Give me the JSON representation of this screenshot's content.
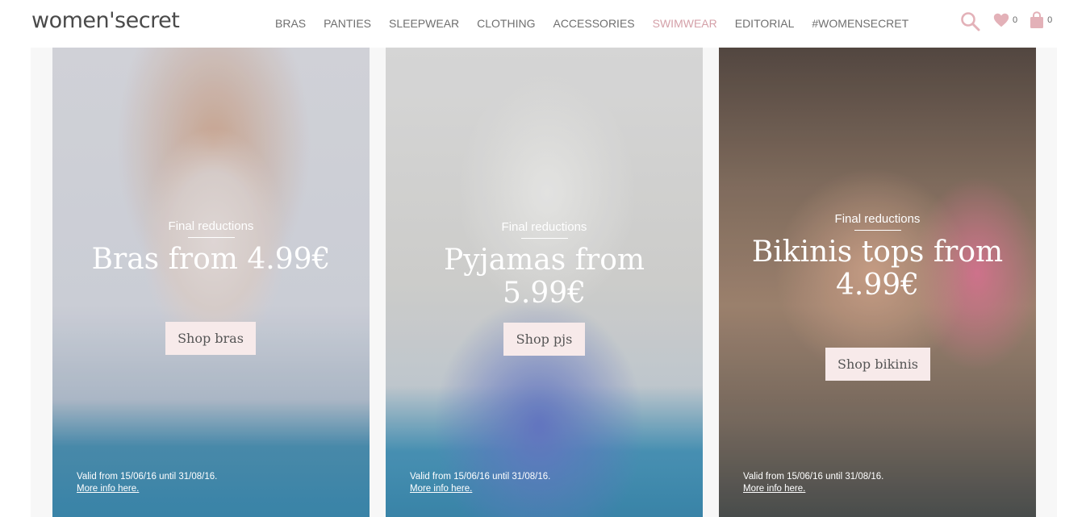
{
  "header": {
    "logo": "women'secret",
    "nav": [
      {
        "label": "BRAS"
      },
      {
        "label": "PANTIES"
      },
      {
        "label": "SLEEPWEAR"
      },
      {
        "label": "CLOTHING"
      },
      {
        "label": "ACCESSORIES"
      },
      {
        "label": "SWIMWEAR",
        "active": true
      },
      {
        "label": "EDITORIAL"
      },
      {
        "label": "#WOMENSECRET"
      }
    ],
    "wishlist_count": "0",
    "bag_count": "0",
    "icons": [
      "search-icon",
      "heart-icon",
      "bag-icon"
    ],
    "accent_color": "#d4a0a8"
  },
  "cards": [
    {
      "eyebrow": "Final reductions",
      "headline": "Bras from 4.99€",
      "button": "Shop bras",
      "valid": "Valid from 15/06/16 until 31/08/16.",
      "more_info": "More info here."
    },
    {
      "eyebrow": "Final reductions",
      "headline": "Pyjamas from 5.99€",
      "button": "Shop pjs",
      "valid": "Valid from 15/06/16 until 31/08/16.",
      "more_info": "More info here."
    },
    {
      "eyebrow": "Final reductions",
      "headline": "Bikinis tops from 4.99€",
      "button": "Shop bikinis",
      "valid": "Valid from 15/06/16 until 31/08/16.",
      "more_info": "More info here."
    }
  ]
}
